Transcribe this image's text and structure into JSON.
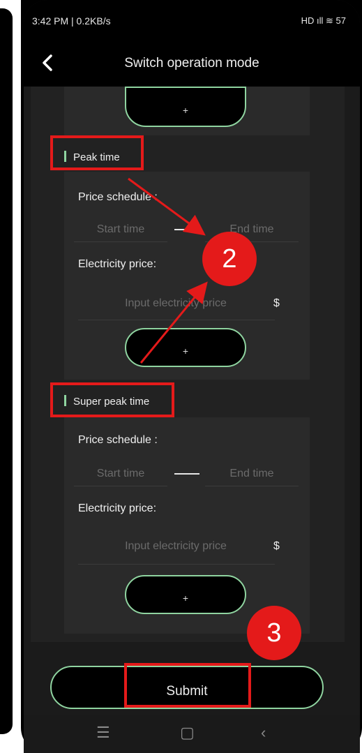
{
  "status_bar": {
    "time_speed": "3:42 PM | 0.2KB/s",
    "right_icons": "HD ıll ≋ 57"
  },
  "header": {
    "title": "Switch operation mode"
  },
  "plus_label": "+",
  "peak": {
    "section_label": "Peak time",
    "price_schedule_label": "Price schedule :",
    "start_placeholder": "Start time",
    "end_placeholder": "End time",
    "price_label": "Electricity price:",
    "price_placeholder": "Input electricity price",
    "currency": "$"
  },
  "super_peak": {
    "section_label": "Super peak time",
    "price_schedule_label": "Price schedule :",
    "start_placeholder": "Start time",
    "end_placeholder": "End time",
    "price_label": "Electricity price:",
    "price_placeholder": "Input electricity price",
    "currency": "$"
  },
  "annotations": {
    "step2": "2",
    "step3": "3"
  },
  "submit_label": "Submit",
  "colors": {
    "accent": "#8fd4a0",
    "annotation_red": "#e41a1a",
    "background": "#1b1b1b"
  }
}
